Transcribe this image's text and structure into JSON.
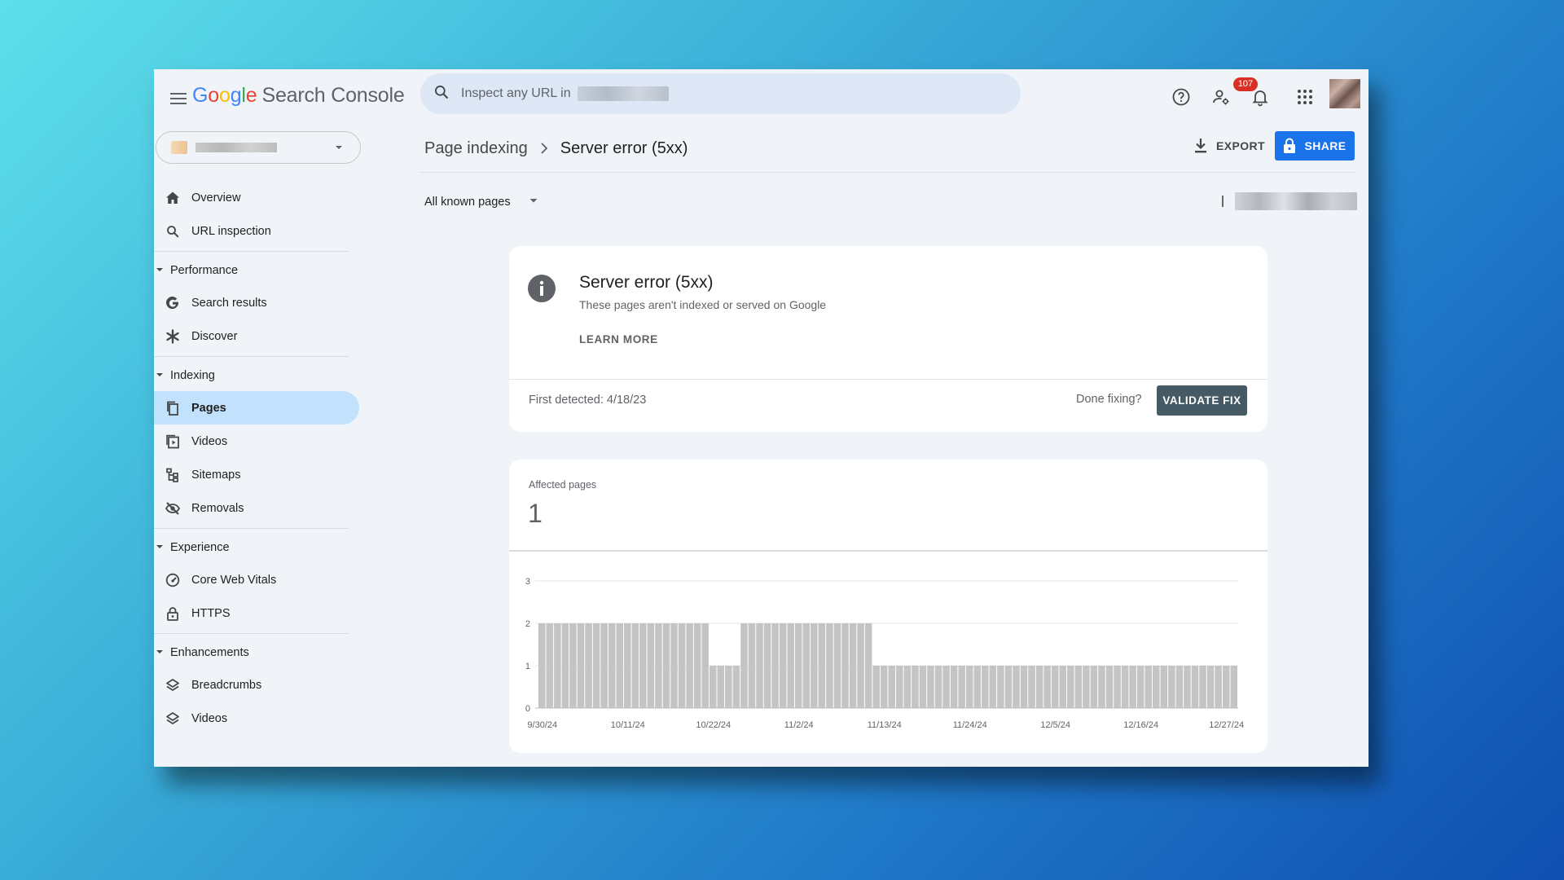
{
  "header": {
    "logo": {
      "g1": "G",
      "o1": "o",
      "o2": "o",
      "g2": "g",
      "l": "l",
      "e": "e",
      "product": "Search Console"
    },
    "search_placeholder": "Inspect any URL in",
    "notification_count": "107"
  },
  "icons": {
    "menu": "hamburger-menu-icon",
    "search": "search-icon",
    "help": "help-circle-icon",
    "users": "person-settings-icon",
    "bell": "bell-icon",
    "apps": "apps-grid-icon"
  },
  "sidebar": {
    "items": [
      {
        "type": "item",
        "label": "Overview",
        "icon": "home-icon"
      },
      {
        "type": "item",
        "label": "URL inspection",
        "icon": "search-icon"
      },
      {
        "type": "section",
        "label": "Performance"
      },
      {
        "type": "item",
        "label": "Search results",
        "icon": "google-g-icon"
      },
      {
        "type": "item",
        "label": "Discover",
        "icon": "asterisk-icon"
      },
      {
        "type": "section",
        "label": "Indexing"
      },
      {
        "type": "item",
        "label": "Pages",
        "icon": "pages-icon",
        "active": true
      },
      {
        "type": "item",
        "label": "Videos",
        "icon": "video-page-icon"
      },
      {
        "type": "item",
        "label": "Sitemaps",
        "icon": "sitemap-icon"
      },
      {
        "type": "item",
        "label": "Removals",
        "icon": "eye-off-icon"
      },
      {
        "type": "section",
        "label": "Experience"
      },
      {
        "type": "item",
        "label": "Core Web Vitals",
        "icon": "gauge-icon"
      },
      {
        "type": "item",
        "label": "HTTPS",
        "icon": "lock-icon"
      },
      {
        "type": "section",
        "label": "Enhancements"
      },
      {
        "type": "item",
        "label": "Breadcrumbs",
        "icon": "layers-icon"
      },
      {
        "type": "item",
        "label": "Videos",
        "icon": "layers-icon"
      }
    ]
  },
  "main": {
    "breadcrumb": {
      "parent": "Page indexing",
      "current": "Server error (5xx)"
    },
    "export_label": "EXPORT",
    "share_label": "SHARE",
    "filter_label": "All known pages",
    "issue": {
      "title": "Server error (5xx)",
      "subtitle": "These pages aren't indexed or served on Google",
      "learn_more": "LEARN MORE",
      "first_detected": "First detected: 4/18/23",
      "done_fixing": "Done fixing?",
      "validate_label": "VALIDATE FIX"
    },
    "affected": {
      "label": "Affected pages",
      "value": "1"
    }
  },
  "chart_data": {
    "type": "bar",
    "title": "",
    "xlabel": "",
    "ylabel": "",
    "ylim": [
      0,
      3
    ],
    "yticks": [
      "0",
      "1",
      "2",
      "3"
    ],
    "xticks": [
      "9/30/24",
      "10/11/24",
      "10/22/24",
      "11/2/24",
      "11/13/24",
      "11/24/24",
      "12/5/24",
      "12/16/24",
      "12/27/24"
    ],
    "x_start": "9/30/24",
    "x_end": "12/28/24",
    "color": "#c4c4c4",
    "segments": [
      {
        "from": "9/30/24",
        "to": "10/21/24",
        "value": 2
      },
      {
        "from": "10/22/24",
        "to": "10/25/24",
        "value": 1
      },
      {
        "from": "10/26/24",
        "to": "11/11/24",
        "value": 2
      },
      {
        "from": "11/12/24",
        "to": "12/28/24",
        "value": 1
      }
    ]
  }
}
